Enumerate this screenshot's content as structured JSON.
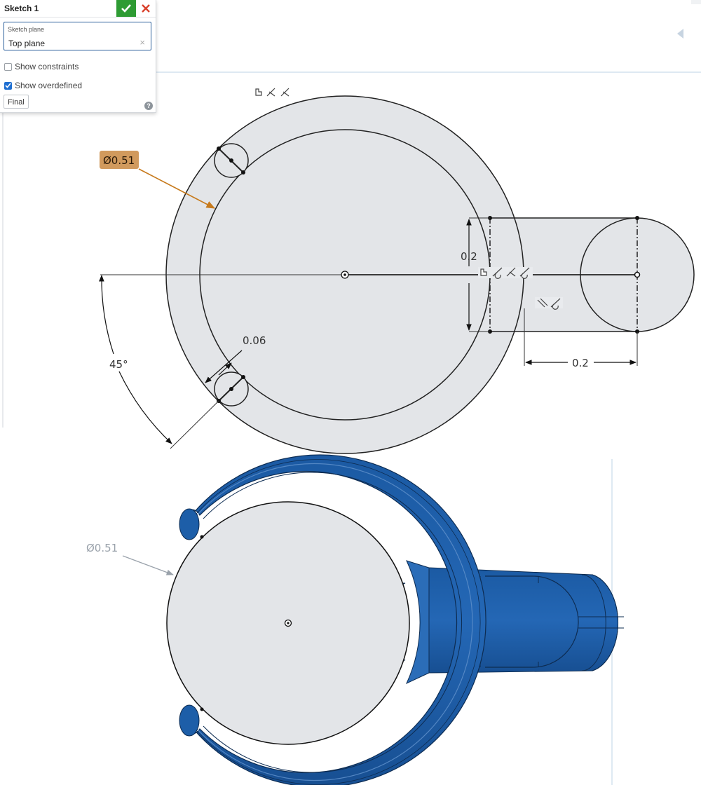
{
  "dialog": {
    "title": "Sketch 1",
    "sketch_plane_label": "Sketch plane",
    "sketch_plane_value": "Top plane",
    "clear_icon": "close-icon",
    "show_constraints_label": "Show constraints",
    "show_constraints_checked": false,
    "show_overdefined_label": "Show overdefined",
    "show_overdefined_checked": true,
    "final_label": "Final",
    "help_glyph": "?"
  },
  "sketch": {
    "outer_diameter_label": "Ø0.51",
    "width_dim": "0.2",
    "length_dim": "0.2",
    "gap_dim": "0.06",
    "angle_dim": "45°"
  },
  "model": {
    "diameter_label": "Ø0.51"
  },
  "colors": {
    "accept_green": "#2e9b33",
    "cancel_red": "#d9412c",
    "highlight_orange": "#d19a5d",
    "arrow_orange": "#c77a1c",
    "part_blue": "#1d5ea8",
    "sketch_fill": "#e3e5e8"
  }
}
